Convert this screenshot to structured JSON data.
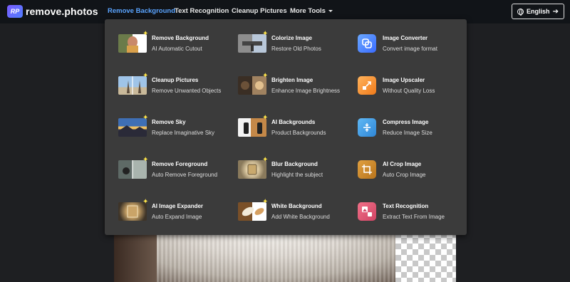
{
  "brand": {
    "logo_mark": "RP",
    "name": "remove.photos"
  },
  "nav": {
    "items": [
      {
        "label": "Remove Background",
        "active": true
      },
      {
        "label": "Text Recognition",
        "active": false
      },
      {
        "label": "Cleanup Pictures",
        "active": false
      },
      {
        "label": "More Tools",
        "active": false,
        "has_dropdown": true
      }
    ],
    "language_button": "English"
  },
  "colors": {
    "active_link": "#5aa4ff",
    "navbar": "#111418",
    "dropdown": "#3b3b3b",
    "sparkle": "#ffe54a"
  },
  "dropdown": {
    "tools": [
      {
        "title": "Remove Background",
        "subtitle": "AI Automatic Cutout",
        "icon": "remove-background-thumbnail",
        "new": true
      },
      {
        "title": "Colorize Image",
        "subtitle": "Restore Old Photos",
        "icon": "colorize-image-thumbnail",
        "new": true
      },
      {
        "title": "Image Converter",
        "subtitle": "Convert image format",
        "icon": "image-converter-icon",
        "new": false
      },
      {
        "title": "Cleanup Pictures",
        "subtitle": "Remove Unwanted Objects",
        "icon": "cleanup-pictures-thumbnail",
        "new": true
      },
      {
        "title": "Brighten Image",
        "subtitle": "Enhance Image Brightness",
        "icon": "brighten-image-thumbnail",
        "new": true
      },
      {
        "title": "Image Upscaler",
        "subtitle": "Without Quality Loss",
        "icon": "image-upscaler-icon",
        "new": false
      },
      {
        "title": "Remove Sky",
        "subtitle": "Replace Imaginative Sky",
        "icon": "remove-sky-thumbnail",
        "new": true
      },
      {
        "title": "AI Backgrounds",
        "subtitle": "Product Backgrounds",
        "icon": "ai-backgrounds-thumbnail",
        "new": true
      },
      {
        "title": "Compress Image",
        "subtitle": "Reduce Image Size",
        "icon": "compress-image-icon",
        "new": false
      },
      {
        "title": "Remove Foreground",
        "subtitle": "Auto Remove Foreground",
        "icon": "remove-foreground-thumbnail",
        "new": true
      },
      {
        "title": "Blur Background",
        "subtitle": "Highlight the subject",
        "icon": "blur-background-thumbnail",
        "new": true
      },
      {
        "title": "AI Crop Image",
        "subtitle": "Auto Crop Image",
        "icon": "ai-crop-image-icon",
        "new": false
      },
      {
        "title": "AI Image Expander",
        "subtitle": "Auto Expand Image",
        "icon": "ai-image-expander-thumbnail",
        "new": true
      },
      {
        "title": "White Background",
        "subtitle": "Add White Background",
        "icon": "white-background-thumbnail",
        "new": true
      },
      {
        "title": "Text Recognition",
        "subtitle": "Extract Text From Image",
        "icon": "text-recognition-icon",
        "new": false
      }
    ]
  }
}
